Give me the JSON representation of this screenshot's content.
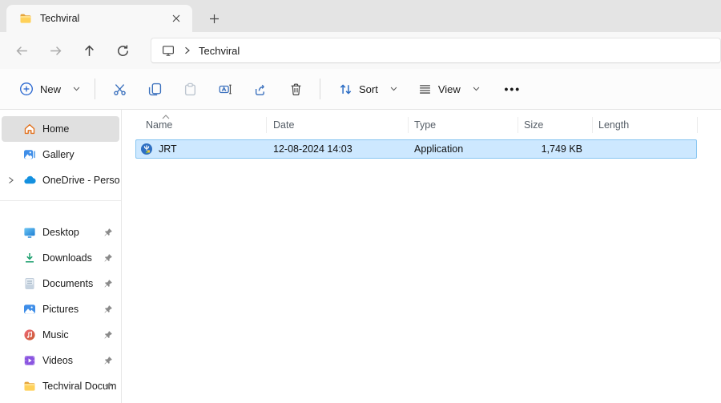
{
  "tabbar": {
    "tab_title": "Techviral"
  },
  "address": {
    "location": "Techviral"
  },
  "toolbar": {
    "new_label": "New",
    "sort_label": "Sort",
    "view_label": "View",
    "more_label": "•••"
  },
  "sidebar": {
    "items": [
      {
        "label": "Home",
        "active": true
      },
      {
        "label": "Gallery"
      },
      {
        "label": "OneDrive - Persona",
        "expandable": true
      },
      {
        "label": "Desktop",
        "pinned": true
      },
      {
        "label": "Downloads",
        "pinned": true
      },
      {
        "label": "Documents",
        "pinned": true
      },
      {
        "label": "Pictures",
        "pinned": true
      },
      {
        "label": "Music",
        "pinned": true
      },
      {
        "label": "Videos",
        "pinned": true
      },
      {
        "label": "Techviral Docum",
        "pinned": true
      }
    ]
  },
  "file_list": {
    "columns": [
      "Name",
      "Date",
      "Type",
      "Size",
      "Length"
    ],
    "sort_column": "Name",
    "sort_direction": "ascending",
    "rows": [
      {
        "name": "JRT",
        "date": "12-08-2024 14:03",
        "type": "Application",
        "size": "1,749 KB",
        "length": ""
      }
    ]
  },
  "colors": {
    "accent_blue": "#2564cf",
    "selection_bg": "#cde8ff",
    "selection_border": "#86c5f1",
    "active_item_bg": "#e0e0e0",
    "tabbar_bg": "#e4e4e4"
  }
}
